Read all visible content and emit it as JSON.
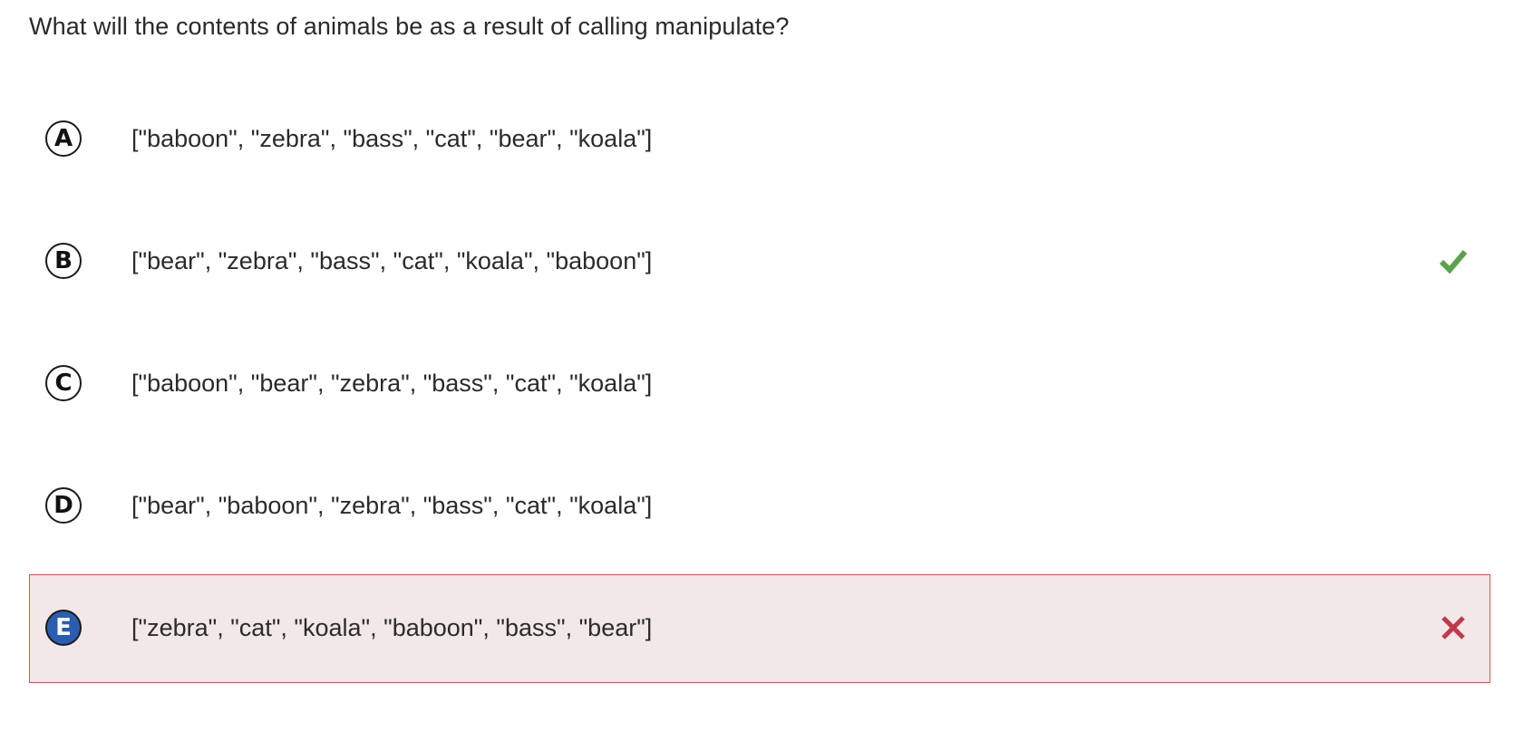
{
  "question": "What will the contents of animals be as a result of calling manipulate?",
  "choices": [
    {
      "letter": "A",
      "text": "[\"baboon\", \"zebra\", \"bass\", \"cat\", \"bear\", \"koala\"]",
      "status": "none"
    },
    {
      "letter": "B",
      "text": "[\"bear\", \"zebra\", \"bass\", \"cat\", \"koala\", \"baboon\"]",
      "status": "correct"
    },
    {
      "letter": "C",
      "text": "[\"baboon\", \"bear\", \"zebra\", \"bass\", \"cat\", \"koala\"]",
      "status": "none"
    },
    {
      "letter": "D",
      "text": "[\"bear\", \"baboon\", \"zebra\", \"bass\", \"cat\", \"koala\"]",
      "status": "none"
    },
    {
      "letter": "E",
      "text": "[\"zebra\", \"cat\", \"koala\", \"baboon\", \"bass\", \"bear\"]",
      "status": "incorrect-selected"
    }
  ],
  "colors": {
    "correct": "#5aa34a",
    "incorrect": "#c0394b",
    "selected_badge": "#2a5db0",
    "wrong_background": "#f3e8e8",
    "wrong_border": "#d9534f"
  },
  "icons": {
    "correct": "checkmark-icon",
    "incorrect": "x-mark-icon"
  }
}
